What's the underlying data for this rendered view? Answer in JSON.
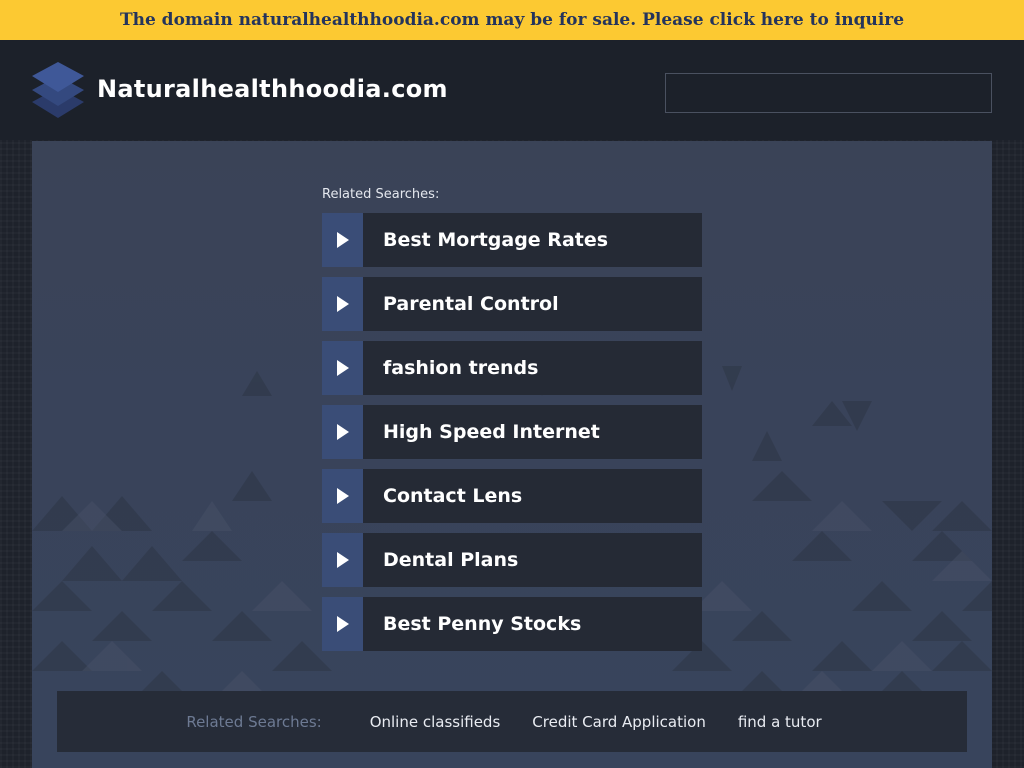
{
  "banner": {
    "text": "The domain naturalhealthhoodia.com may be for sale. Please click here to inquire",
    "color": "#fcc932"
  },
  "header": {
    "title": "Naturalhealthhoodia.com",
    "logo_icon": "stacked-layers-icon",
    "search": {
      "value": "",
      "placeholder": ""
    }
  },
  "main": {
    "related_label": "Related Searches:",
    "links": [
      {
        "label": "Best Mortgage Rates",
        "icon": "play-arrow-icon"
      },
      {
        "label": "Parental Control",
        "icon": "play-arrow-icon"
      },
      {
        "label": "fashion trends",
        "icon": "play-arrow-icon"
      },
      {
        "label": "High Speed Internet",
        "icon": "play-arrow-icon"
      },
      {
        "label": "Contact Lens",
        "icon": "play-arrow-icon"
      },
      {
        "label": "Dental Plans",
        "icon": "play-arrow-icon"
      },
      {
        "label": "Best Penny Stocks",
        "icon": "play-arrow-icon"
      }
    ]
  },
  "footer": {
    "label": "Related Searches:",
    "links": [
      "Online classifieds",
      "Credit Card Application",
      "find a tutor"
    ]
  },
  "colors": {
    "accent": "#3a4d77",
    "link_bg": "#252a35",
    "page_bg": "#1e222b"
  }
}
